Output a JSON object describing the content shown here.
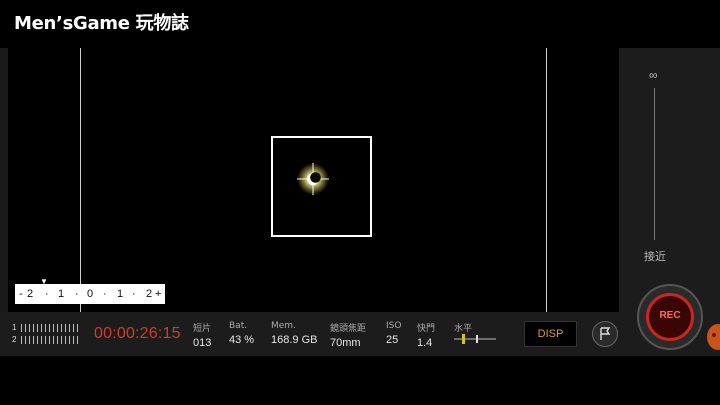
{
  "brand": {
    "logo_text": "Men’sGame 玩物誌"
  },
  "viewfinder": {
    "level_scale": [
      "-",
      "2",
      "·",
      "1",
      "·",
      "0",
      "·",
      "1",
      "·",
      "2",
      "+"
    ]
  },
  "focus_panel": {
    "far_label": "∞",
    "near_label": "接近"
  },
  "status": {
    "audio_channels": [
      "1",
      "2"
    ],
    "timecode": "00:00:26:15",
    "clips_label": "短片",
    "clips_value": "013",
    "battery_label": "Bat.",
    "battery_value": "43 %",
    "memory_label": "Mem.",
    "memory_value": "168.9 GB",
    "focal_label": "鏡頭焦距",
    "focal_value": "70mm",
    "iso_label": "ISO",
    "iso_value": "25",
    "shutter_label": "快門",
    "shutter_value": "1.4",
    "horizon_label": "水平"
  },
  "controls": {
    "disp_label": "DISP",
    "rec_label": "REC",
    "flag_icon": "flag-icon"
  },
  "colors": {
    "accent_red": "#d33b2a",
    "disp_text": "#d9a11b",
    "rec_ring": "#c8281c"
  }
}
